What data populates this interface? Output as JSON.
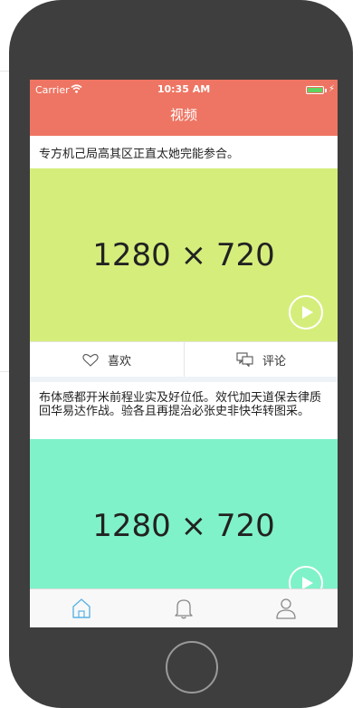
{
  "status_bar": {
    "carrier": "Carrier",
    "time": "10:35 AM"
  },
  "nav": {
    "title": "视频"
  },
  "feed": {
    "items": [
      {
        "title": "专方机己局高其区正直太她完能参合。",
        "thumbnail_label": "1280 × 720",
        "thumbnail_color": "#d5ee7b",
        "like_label": "喜欢",
        "comment_label": "评论"
      },
      {
        "title": "布体感都开米前程业实及好位低。效代加天道保去律质回华易达作战。验各且再提治必张史非快华转图采。",
        "thumbnail_label": "1280 × 720",
        "thumbnail_color": "#7ff2c9"
      }
    ]
  },
  "tabbar": {
    "tabs": [
      "home-icon",
      "bell-icon",
      "profile-icon"
    ],
    "active_color": "#5bb3e4"
  },
  "colors": {
    "header": "#ee7563",
    "phone_shell": "#3e3e3e"
  }
}
